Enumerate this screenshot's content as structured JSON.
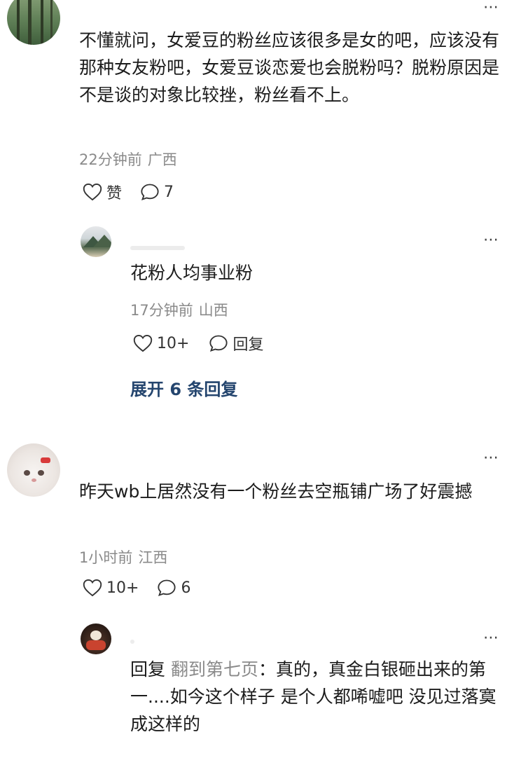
{
  "comments": [
    {
      "text": "不懂就问，女爱豆的粉丝应该很多是女的吧，应该没有那种女友粉吧，女爱豆谈恋爱也会脱粉吗？脱粉原因是不是谈的对象比较挫，粉丝看不上。",
      "time": "22分钟前",
      "location": "广西",
      "like_label": "赞",
      "comment_count": "7",
      "reply": {
        "text": "花粉人均事业粉",
        "time": "17分钟前",
        "location": "山西",
        "like_count": "10+",
        "reply_label": "回复"
      },
      "expand_label": "展开 6 条回复"
    },
    {
      "text": "昨天wb上居然没有一个粉丝去空瓶铺广场了好震撼",
      "time": "1小时前",
      "location": "江西",
      "like_count": "10+",
      "comment_count": "6",
      "reply": {
        "prefix": "回复",
        "target": "翻到第七页",
        "text": "：真的，真金白银砸出来的第一....如今这个样子 是个人都唏嘘吧 没见过落寞成这样的"
      }
    }
  ],
  "more_icon": "⋯",
  "icons": {
    "like": "heart-outline-icon",
    "comment": "speech-bubble-icon",
    "more": "more-dots-icon"
  }
}
